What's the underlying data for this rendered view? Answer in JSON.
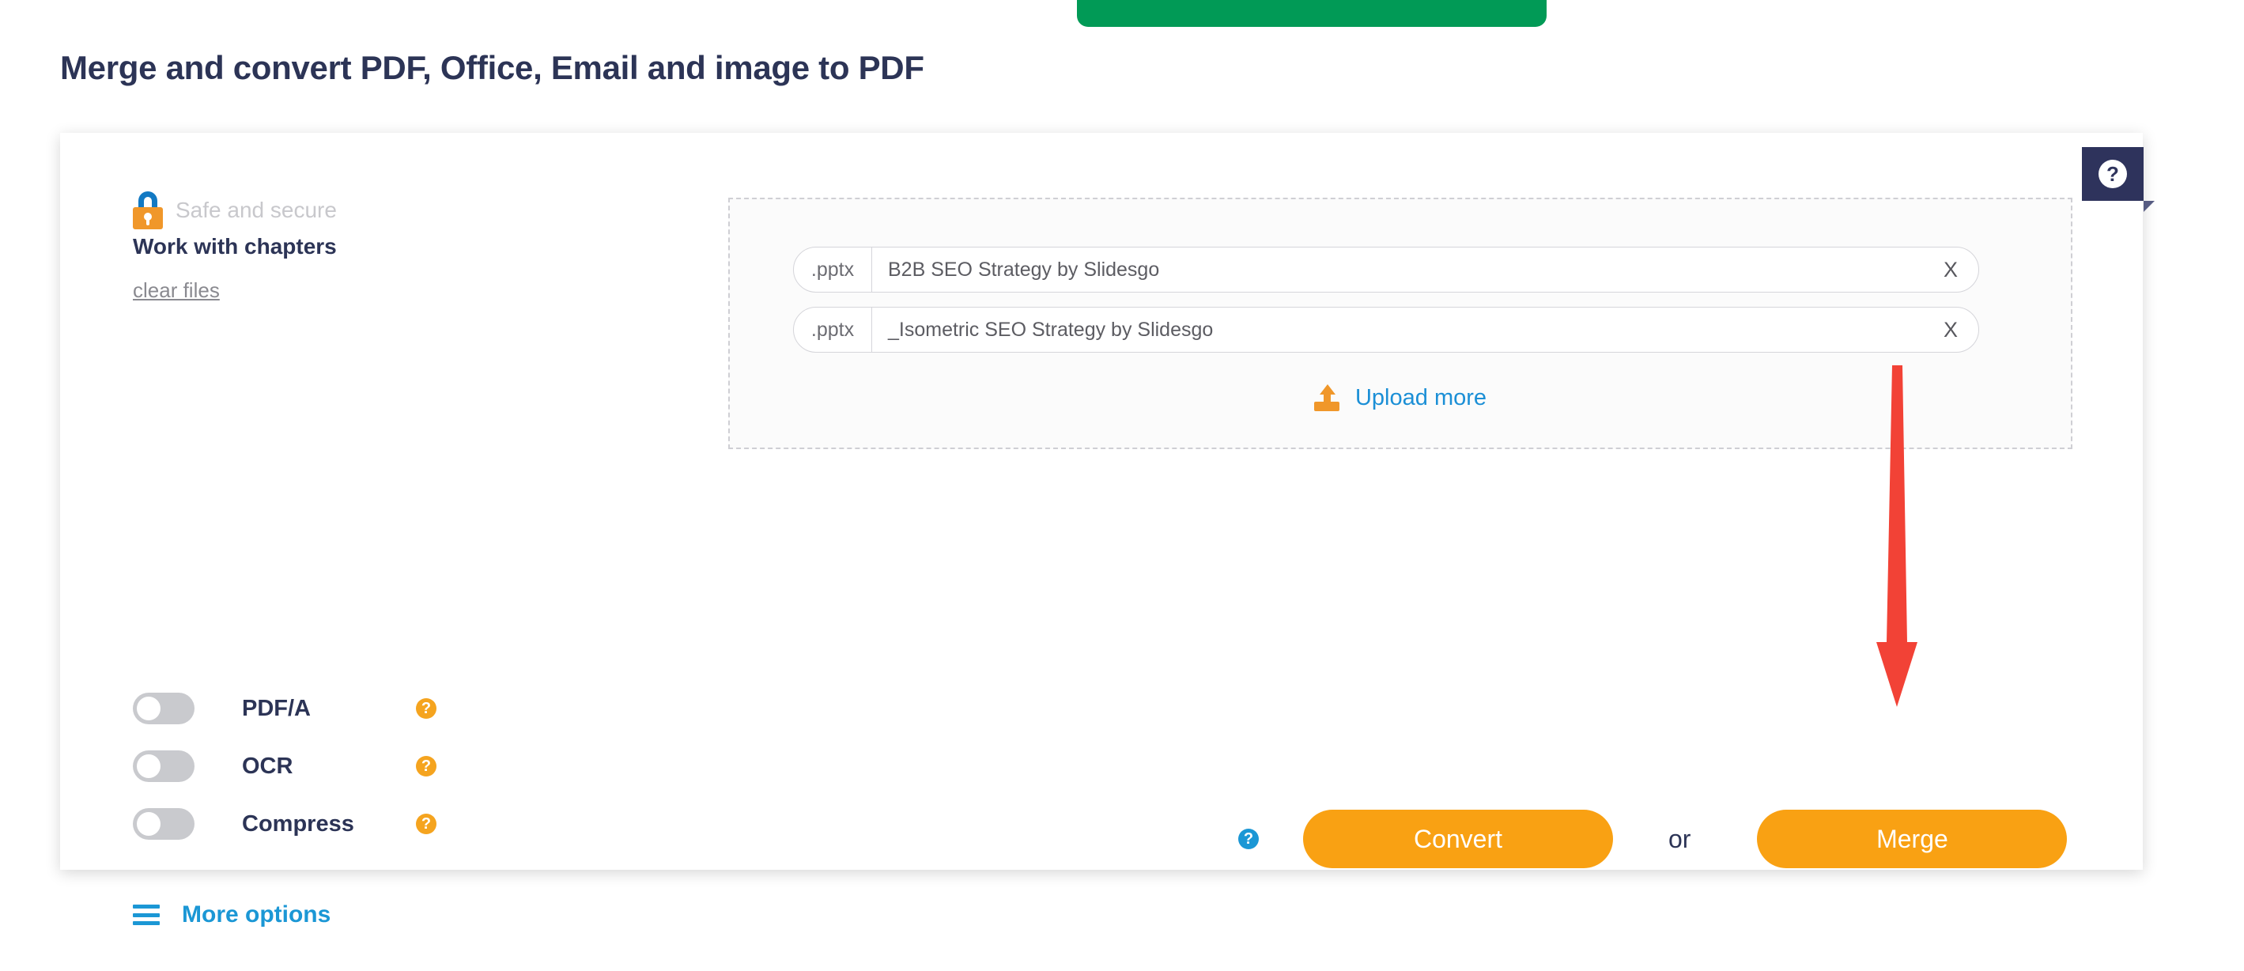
{
  "page": {
    "title": "Merge and convert PDF, Office, Email and image to PDF"
  },
  "sidebar": {
    "safe_label": "Safe and secure",
    "lock_icon": "lock-icon",
    "chapters_label": "Work with chapters",
    "clear_files_label": "clear files",
    "options": [
      {
        "label": "PDF/A",
        "enabled": false,
        "help_icon": "help-circle-icon"
      },
      {
        "label": "OCR",
        "enabled": false,
        "help_icon": "help-circle-icon"
      },
      {
        "label": "Compress",
        "enabled": false,
        "help_icon": "help-circle-icon"
      }
    ],
    "more_options_label": "More options",
    "more_options_icon": "hamburger-icon"
  },
  "dropzone": {
    "files": [
      {
        "ext": ".pptx",
        "name": "B2B SEO Strategy by Slidesgo",
        "close_label": "X"
      },
      {
        "ext": ".pptx",
        "name": "_Isometric SEO Strategy by Slidesgo",
        "close_label": "X"
      }
    ],
    "upload_more_label": "Upload more",
    "upload_icon": "upload-icon"
  },
  "actions": {
    "help_icon": "help-circle-icon",
    "convert_label": "Convert",
    "or_label": "or",
    "merge_label": "Merge"
  },
  "help_tab": {
    "icon": "question-mark-icon",
    "label": "?"
  },
  "annotation": {
    "arrow_color": "#f24236",
    "points_to": "Merge"
  },
  "colors": {
    "accent_orange": "#f9a113",
    "accent_blue": "#1b97d5",
    "navy": "#2c3456",
    "green": "#019a56"
  }
}
